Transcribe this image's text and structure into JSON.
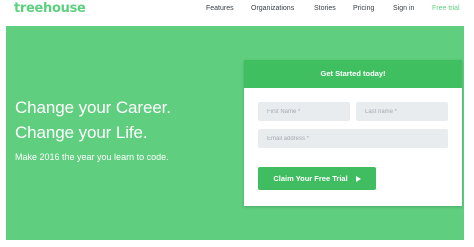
{
  "brand": {
    "logo_text": "treehouse",
    "accent": "#5fcf80",
    "hero_bg": "#5fce7e",
    "button_bg": "#41bd61"
  },
  "nav": {
    "items": [
      {
        "label": "Features"
      },
      {
        "label": "Organizations"
      },
      {
        "label": "Stories"
      },
      {
        "label": "Pricing"
      },
      {
        "label": "Sign in"
      },
      {
        "label": "Free trial"
      }
    ]
  },
  "hero": {
    "headline_line1": "Change your Career.",
    "headline_line2": "Change your Life.",
    "subline": "Make 2016 the year you learn to code."
  },
  "signup": {
    "title": "Get Started today!",
    "first_name_placeholder": "First Name *",
    "last_name_placeholder": "Last name *",
    "email_placeholder": "Email address *",
    "cta_label": "Claim Your Free Trial"
  }
}
